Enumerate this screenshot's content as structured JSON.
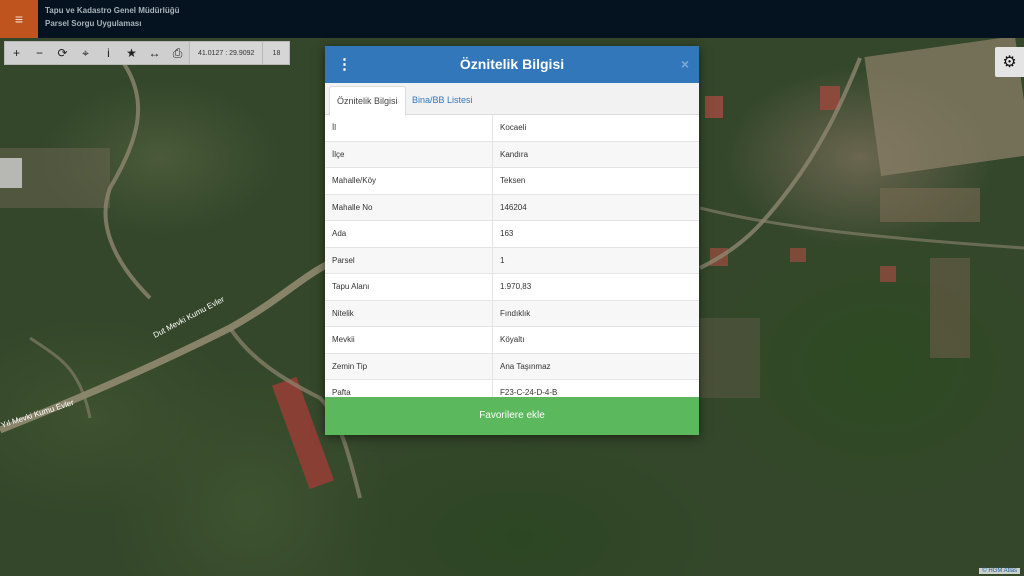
{
  "header": {
    "title": "Tapu ve Kadastro Genel Müdürlüğü",
    "subtitle": "Parsel Sorgu Uygulaması",
    "menu_icon": "≡"
  },
  "toolbar": {
    "tools": [
      {
        "name": "zoom-in-icon",
        "glyph": "+"
      },
      {
        "name": "zoom-out-icon",
        "glyph": "−"
      },
      {
        "name": "refresh-icon",
        "glyph": "⟳"
      },
      {
        "name": "locate-icon",
        "glyph": "⌖"
      },
      {
        "name": "info-icon",
        "glyph": "i"
      },
      {
        "name": "star-icon",
        "glyph": "★"
      },
      {
        "name": "measure-icon",
        "glyph": "↔"
      },
      {
        "name": "print-icon",
        "glyph": "⎙"
      }
    ],
    "coordinates": "41.0127 : 29.9092",
    "zoom_level": "18"
  },
  "settings_icon": "⚙",
  "map_labels": {
    "road1": "Dut Mevki Kumu Evler",
    "road2": "Yıl Mevki Kumu Evler"
  },
  "attribution": "© HGM Atlas",
  "modal": {
    "title": "Öznitelik Bilgisi",
    "kebab_icon": "⋮",
    "close_icon": "×",
    "tabs": [
      "Öznitelik Bilgisi",
      "Bina/BB Listesi"
    ],
    "rows": [
      {
        "key": "İl",
        "value": "Kocaeli"
      },
      {
        "key": "İlçe",
        "value": "Kandıra"
      },
      {
        "key": "Mahalle/Köy",
        "value": "Teksen"
      },
      {
        "key": "Mahalle No",
        "value": "146204"
      },
      {
        "key": "Ada",
        "value": "163"
      },
      {
        "key": "Parsel",
        "value": "1"
      },
      {
        "key": "Tapu Alanı",
        "value": "1.970,83"
      },
      {
        "key": "Nitelik",
        "value": "Fındıklık"
      },
      {
        "key": "Mevkii",
        "value": "Köyaltı"
      },
      {
        "key": "Zemin Tip",
        "value": "Ana Taşınmaz"
      },
      {
        "key": "Pafta",
        "value": "F23-C-24-D-4-B"
      }
    ],
    "favorite_button": "Favorilere ekle"
  },
  "colors": {
    "header_bg": "#04131f",
    "menu_accent": "#c0541e",
    "modal_header": "#3377bb",
    "favorite_button": "#5cb85c"
  }
}
